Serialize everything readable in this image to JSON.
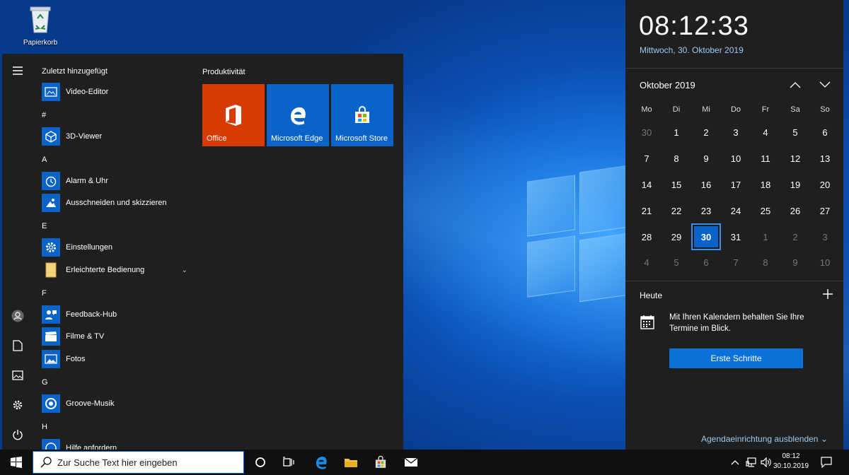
{
  "desktop": {
    "recycle_bin_label": "Papierkorb"
  },
  "start_menu": {
    "recent_header": "Zuletzt hinzugefügt",
    "apps": [
      {
        "label": "Video-Editor",
        "icon": "video-editor-icon"
      },
      {
        "label": "3D-Viewer",
        "icon": "3d-viewer-icon"
      },
      {
        "label": "Alarm & Uhr",
        "icon": "alarm-clock-icon"
      },
      {
        "label": "Ausschneiden und skizzieren",
        "icon": "snip-sketch-icon"
      },
      {
        "label": "Einstellungen",
        "icon": "settings-gear-icon"
      },
      {
        "label": "Erleichterte Bedienung",
        "icon": "folder-icon"
      },
      {
        "label": "Feedback-Hub",
        "icon": "feedback-hub-icon"
      },
      {
        "label": "Filme & TV",
        "icon": "film-icon"
      },
      {
        "label": "Fotos",
        "icon": "photos-icon"
      },
      {
        "label": "Groove-Musik",
        "icon": "groove-music-icon"
      },
      {
        "label": "Hilfe anfordern",
        "icon": "help-icon"
      }
    ],
    "sections": [
      "#",
      "A",
      "E",
      "F",
      "G",
      "H"
    ],
    "tile_group": "Produktivität",
    "tiles": [
      {
        "label": "Office",
        "color": "#d83b01",
        "icon": "office-icon"
      },
      {
        "label": "Microsoft Edge",
        "color": "#0a63c9",
        "icon": "edge-icon"
      },
      {
        "label": "Microsoft Store",
        "color": "#0a63c9",
        "icon": "store-icon"
      }
    ]
  },
  "calendar": {
    "time": "08:12:33",
    "date": "Mittwoch, 30. Oktober 2019",
    "month_title": "Oktober 2019",
    "weekdays": [
      "Mo",
      "Di",
      "Mi",
      "Do",
      "Fr",
      "Sa",
      "So"
    ],
    "weeks": [
      [
        "30",
        "1",
        "2",
        "3",
        "4",
        "5",
        "6"
      ],
      [
        "7",
        "8",
        "9",
        "10",
        "11",
        "12",
        "13"
      ],
      [
        "14",
        "15",
        "16",
        "17",
        "18",
        "19",
        "20"
      ],
      [
        "21",
        "22",
        "23",
        "24",
        "25",
        "26",
        "27"
      ],
      [
        "28",
        "29",
        "30",
        "31",
        "1",
        "2",
        "3"
      ],
      [
        "4",
        "5",
        "6",
        "7",
        "8",
        "9",
        "10"
      ]
    ],
    "today_label": "Heute",
    "agenda_message": "Mit Ihren Kalendern behalten Sie Ihre Termine im Blick.",
    "get_started_button": "Erste Schritte",
    "hide_agenda_link": "Agendaeinrichtung ausblenden"
  },
  "taskbar": {
    "search_placeholder": "Zur Suche Text hier eingeben",
    "clock_time": "08:12",
    "clock_date": "30.10.2019"
  },
  "colors": {
    "accent": "#0a63c9",
    "office": "#d83b01",
    "panel": "#1f1f1f",
    "taskbar": "#101010"
  }
}
